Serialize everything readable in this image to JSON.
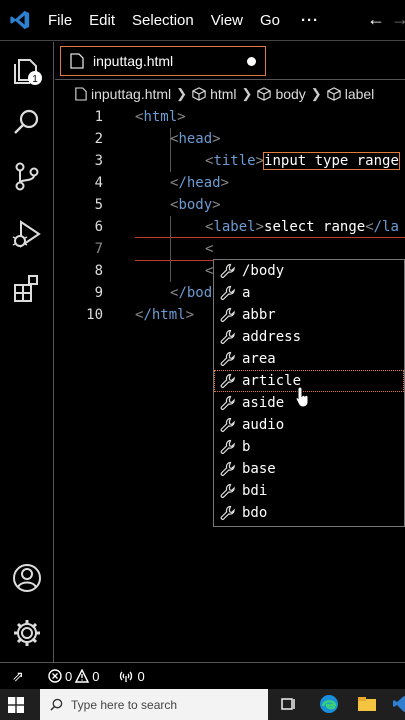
{
  "menu": {
    "items": [
      "File",
      "Edit",
      "Selection",
      "View",
      "Go"
    ],
    "more": "···"
  },
  "activity": {
    "explorer_badge": "1"
  },
  "tab": {
    "label": "inputtag.html"
  },
  "breadcrumb": {
    "file": "inputtag.html",
    "items": [
      "html",
      "body",
      "label"
    ]
  },
  "editor": {
    "line_numbers": [
      "1",
      "2",
      "3",
      "4",
      "5",
      "6",
      "7",
      "8",
      "9",
      "10"
    ],
    "lines": {
      "l1_tag": "html",
      "l2_tag": "head",
      "l3_tag": "title",
      "l3_text": "input type range",
      "l4_tag": "/head",
      "l5_tag": "body",
      "l6_tag": "label",
      "l6_text": "select range",
      "l6_close": "/la",
      "l7_text": "<",
      "l8_text": "<",
      "l9_tag": "/bod",
      "l10_tag": "/html"
    }
  },
  "suggest": {
    "items": [
      "/body",
      "a",
      "abbr",
      "address",
      "area",
      "article",
      "aside",
      "audio",
      "b",
      "base",
      "bdi",
      "bdo"
    ],
    "selected_index": 5
  },
  "status": {
    "errors": "0",
    "warnings": "0",
    "ports": "0"
  },
  "taskbar": {
    "search_placeholder": "Type here to search"
  },
  "colors": {
    "tag": "#6c9bd2",
    "accent": "#e07b3a",
    "current_line": "#c0392b",
    "vscode_blue": "#2f7fd0"
  }
}
